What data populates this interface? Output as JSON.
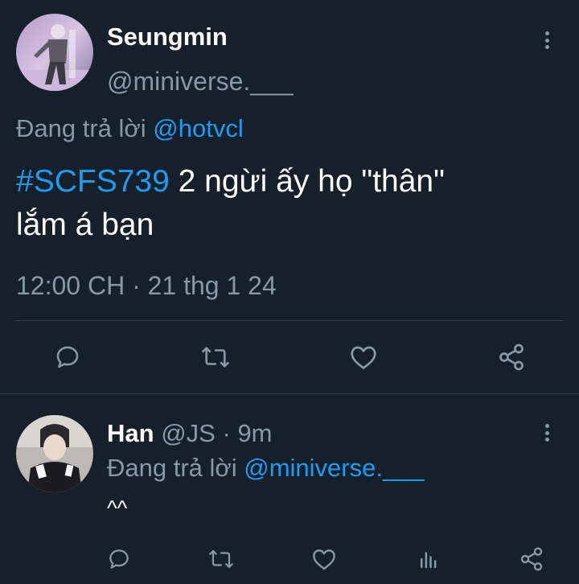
{
  "main_tweet": {
    "display_name": "Seungmin",
    "handle": "@miniverse.___",
    "replying_to_prefix": "Đang trả lời",
    "replying_to_handle": "@hotvcl",
    "hashtag": "#SCFS739",
    "text_line1_rest": " 2 ngừi ấy họ \"thân\"",
    "text_line2": "lắm á bạn",
    "timestamp": "12:00 CH · 21 thg 1 24",
    "actions": [
      "reply-icon",
      "retweet-icon",
      "like-icon",
      "share-icon"
    ]
  },
  "reply_tweet": {
    "display_name": "Han",
    "handle": "@JS",
    "separator": "·",
    "time_ago": "9m",
    "replying_to_prefix": "Đang trả lời",
    "replying_to_handle": "@miniverse.___",
    "text": "^^",
    "actions": [
      "reply-icon",
      "retweet-icon",
      "like-icon",
      "analytics-icon",
      "share-icon"
    ]
  },
  "colors": {
    "background": "#15202b",
    "accent_blue": "#1d9bf0",
    "muted_gray": "#8899a6",
    "divider": "#38444d"
  }
}
